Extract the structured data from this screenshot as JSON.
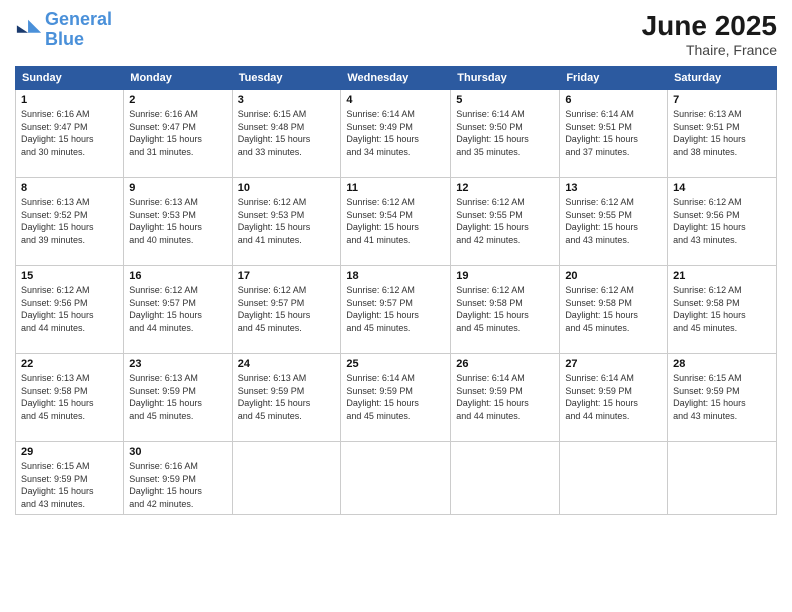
{
  "logo": {
    "line1": "General",
    "line2": "Blue"
  },
  "title": "June 2025",
  "location": "Thaire, France",
  "days_of_week": [
    "Sunday",
    "Monday",
    "Tuesday",
    "Wednesday",
    "Thursday",
    "Friday",
    "Saturday"
  ],
  "weeks": [
    [
      {
        "day": "1",
        "detail": "Sunrise: 6:16 AM\nSunset: 9:47 PM\nDaylight: 15 hours\nand 30 minutes."
      },
      {
        "day": "2",
        "detail": "Sunrise: 6:16 AM\nSunset: 9:47 PM\nDaylight: 15 hours\nand 31 minutes."
      },
      {
        "day": "3",
        "detail": "Sunrise: 6:15 AM\nSunset: 9:48 PM\nDaylight: 15 hours\nand 33 minutes."
      },
      {
        "day": "4",
        "detail": "Sunrise: 6:14 AM\nSunset: 9:49 PM\nDaylight: 15 hours\nand 34 minutes."
      },
      {
        "day": "5",
        "detail": "Sunrise: 6:14 AM\nSunset: 9:50 PM\nDaylight: 15 hours\nand 35 minutes."
      },
      {
        "day": "6",
        "detail": "Sunrise: 6:14 AM\nSunset: 9:51 PM\nDaylight: 15 hours\nand 37 minutes."
      },
      {
        "day": "7",
        "detail": "Sunrise: 6:13 AM\nSunset: 9:51 PM\nDaylight: 15 hours\nand 38 minutes."
      }
    ],
    [
      {
        "day": "8",
        "detail": "Sunrise: 6:13 AM\nSunset: 9:52 PM\nDaylight: 15 hours\nand 39 minutes."
      },
      {
        "day": "9",
        "detail": "Sunrise: 6:13 AM\nSunset: 9:53 PM\nDaylight: 15 hours\nand 40 minutes."
      },
      {
        "day": "10",
        "detail": "Sunrise: 6:12 AM\nSunset: 9:53 PM\nDaylight: 15 hours\nand 41 minutes."
      },
      {
        "day": "11",
        "detail": "Sunrise: 6:12 AM\nSunset: 9:54 PM\nDaylight: 15 hours\nand 41 minutes."
      },
      {
        "day": "12",
        "detail": "Sunrise: 6:12 AM\nSunset: 9:55 PM\nDaylight: 15 hours\nand 42 minutes."
      },
      {
        "day": "13",
        "detail": "Sunrise: 6:12 AM\nSunset: 9:55 PM\nDaylight: 15 hours\nand 43 minutes."
      },
      {
        "day": "14",
        "detail": "Sunrise: 6:12 AM\nSunset: 9:56 PM\nDaylight: 15 hours\nand 43 minutes."
      }
    ],
    [
      {
        "day": "15",
        "detail": "Sunrise: 6:12 AM\nSunset: 9:56 PM\nDaylight: 15 hours\nand 44 minutes."
      },
      {
        "day": "16",
        "detail": "Sunrise: 6:12 AM\nSunset: 9:57 PM\nDaylight: 15 hours\nand 44 minutes."
      },
      {
        "day": "17",
        "detail": "Sunrise: 6:12 AM\nSunset: 9:57 PM\nDaylight: 15 hours\nand 45 minutes."
      },
      {
        "day": "18",
        "detail": "Sunrise: 6:12 AM\nSunset: 9:57 PM\nDaylight: 15 hours\nand 45 minutes."
      },
      {
        "day": "19",
        "detail": "Sunrise: 6:12 AM\nSunset: 9:58 PM\nDaylight: 15 hours\nand 45 minutes."
      },
      {
        "day": "20",
        "detail": "Sunrise: 6:12 AM\nSunset: 9:58 PM\nDaylight: 15 hours\nand 45 minutes."
      },
      {
        "day": "21",
        "detail": "Sunrise: 6:12 AM\nSunset: 9:58 PM\nDaylight: 15 hours\nand 45 minutes."
      }
    ],
    [
      {
        "day": "22",
        "detail": "Sunrise: 6:13 AM\nSunset: 9:58 PM\nDaylight: 15 hours\nand 45 minutes."
      },
      {
        "day": "23",
        "detail": "Sunrise: 6:13 AM\nSunset: 9:59 PM\nDaylight: 15 hours\nand 45 minutes."
      },
      {
        "day": "24",
        "detail": "Sunrise: 6:13 AM\nSunset: 9:59 PM\nDaylight: 15 hours\nand 45 minutes."
      },
      {
        "day": "25",
        "detail": "Sunrise: 6:14 AM\nSunset: 9:59 PM\nDaylight: 15 hours\nand 45 minutes."
      },
      {
        "day": "26",
        "detail": "Sunrise: 6:14 AM\nSunset: 9:59 PM\nDaylight: 15 hours\nand 44 minutes."
      },
      {
        "day": "27",
        "detail": "Sunrise: 6:14 AM\nSunset: 9:59 PM\nDaylight: 15 hours\nand 44 minutes."
      },
      {
        "day": "28",
        "detail": "Sunrise: 6:15 AM\nSunset: 9:59 PM\nDaylight: 15 hours\nand 43 minutes."
      }
    ],
    [
      {
        "day": "29",
        "detail": "Sunrise: 6:15 AM\nSunset: 9:59 PM\nDaylight: 15 hours\nand 43 minutes."
      },
      {
        "day": "30",
        "detail": "Sunrise: 6:16 AM\nSunset: 9:59 PM\nDaylight: 15 hours\nand 42 minutes."
      },
      null,
      null,
      null,
      null,
      null
    ]
  ]
}
